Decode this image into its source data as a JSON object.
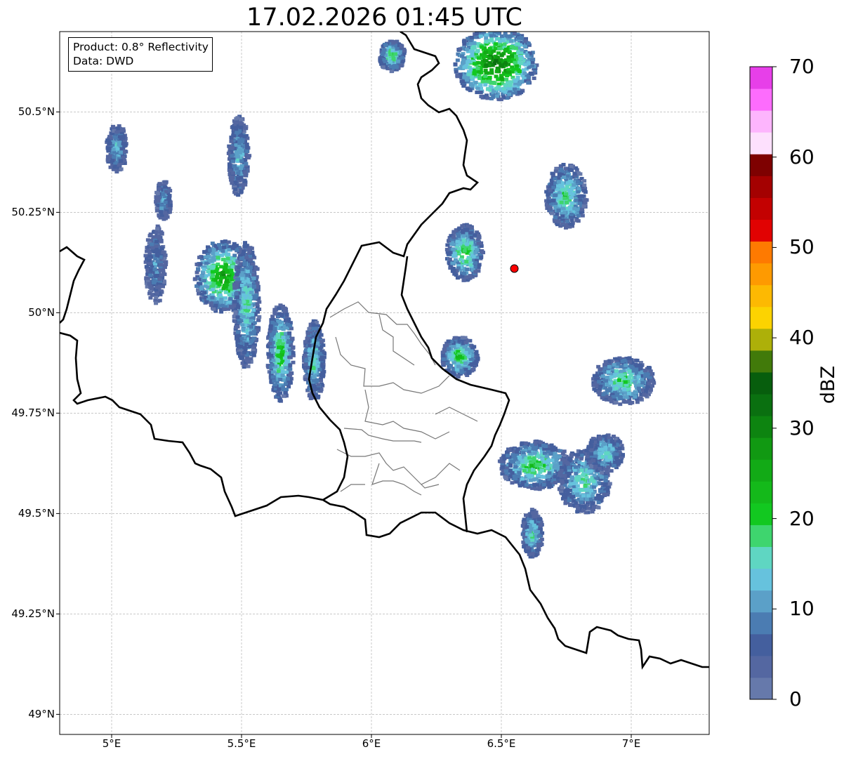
{
  "title": "17.02.2026 01:45 UTC",
  "info_box": {
    "product_line": "Product: 0.8° Reflectivity",
    "data_line": "Data: DWD"
  },
  "map": {
    "lon_range": [
      4.8,
      7.3
    ],
    "lat_range": [
      48.95,
      50.7
    ],
    "lat_ticks": [
      {
        "value": 50.5,
        "label": "50.5°N"
      },
      {
        "value": 50.25,
        "label": "50.25°N"
      },
      {
        "value": 50.0,
        "label": "50°N"
      },
      {
        "value": 49.75,
        "label": "49.75°N"
      },
      {
        "value": 49.5,
        "label": "49.5°N"
      },
      {
        "value": 49.25,
        "label": "49.25°N"
      },
      {
        "value": 49.0,
        "label": "49°N"
      }
    ],
    "lon_ticks": [
      {
        "value": 5.0,
        "label": "5°E"
      },
      {
        "value": 5.5,
        "label": "5.5°E"
      },
      {
        "value": 6.0,
        "label": "6°E"
      },
      {
        "value": 6.5,
        "label": "6.5°E"
      },
      {
        "value": 7.0,
        "label": "7°E"
      }
    ],
    "grid": true,
    "radar_site": {
      "lon": 6.55,
      "lat": 50.11,
      "color": "#ff0000"
    },
    "echoes": [
      {
        "lon": 5.43,
        "lat": 50.09,
        "rx": 0.11,
        "ry": 0.09,
        "max_dbz": 28
      },
      {
        "lon": 5.52,
        "lat": 50.02,
        "rx": 0.05,
        "ry": 0.16,
        "max_dbz": 18
      },
      {
        "lon": 5.65,
        "lat": 49.9,
        "rx": 0.05,
        "ry": 0.12,
        "max_dbz": 22
      },
      {
        "lon": 5.78,
        "lat": 49.88,
        "rx": 0.04,
        "ry": 0.1,
        "max_dbz": 18
      },
      {
        "lon": 5.49,
        "lat": 50.39,
        "rx": 0.04,
        "ry": 0.1,
        "max_dbz": 14
      },
      {
        "lon": 5.02,
        "lat": 50.41,
        "rx": 0.04,
        "ry": 0.06,
        "max_dbz": 14
      },
      {
        "lon": 5.17,
        "lat": 50.12,
        "rx": 0.04,
        "ry": 0.1,
        "max_dbz": 10
      },
      {
        "lon": 5.2,
        "lat": 50.28,
        "rx": 0.03,
        "ry": 0.05,
        "max_dbz": 12
      },
      {
        "lon": 6.48,
        "lat": 50.62,
        "rx": 0.16,
        "ry": 0.09,
        "max_dbz": 34
      },
      {
        "lon": 6.08,
        "lat": 50.64,
        "rx": 0.05,
        "ry": 0.04,
        "max_dbz": 20
      },
      {
        "lon": 6.75,
        "lat": 50.29,
        "rx": 0.08,
        "ry": 0.08,
        "max_dbz": 20
      },
      {
        "lon": 6.36,
        "lat": 50.15,
        "rx": 0.07,
        "ry": 0.07,
        "max_dbz": 22
      },
      {
        "lon": 6.34,
        "lat": 49.89,
        "rx": 0.07,
        "ry": 0.05,
        "max_dbz": 22
      },
      {
        "lon": 6.63,
        "lat": 49.62,
        "rx": 0.14,
        "ry": 0.06,
        "max_dbz": 22
      },
      {
        "lon": 6.97,
        "lat": 49.83,
        "rx": 0.12,
        "ry": 0.06,
        "max_dbz": 20
      },
      {
        "lon": 6.82,
        "lat": 49.58,
        "rx": 0.1,
        "ry": 0.08,
        "max_dbz": 18
      },
      {
        "lon": 6.62,
        "lat": 49.45,
        "rx": 0.04,
        "ry": 0.06,
        "max_dbz": 18
      },
      {
        "lon": 6.9,
        "lat": 49.65,
        "rx": 0.07,
        "ry": 0.05,
        "max_dbz": 16
      }
    ]
  },
  "colorbar": {
    "label": "dBZ",
    "min": 0,
    "max": 70,
    "ticks": [
      {
        "value": 0,
        "label": "0"
      },
      {
        "value": 10,
        "label": "10"
      },
      {
        "value": 20,
        "label": "20"
      },
      {
        "value": 30,
        "label": "30"
      },
      {
        "value": 40,
        "label": "40"
      },
      {
        "value": 50,
        "label": "50"
      },
      {
        "value": 60,
        "label": "60"
      },
      {
        "value": 70,
        "label": "70"
      }
    ],
    "colors": [
      "#6679ab",
      "#5467a1",
      "#445f9e",
      "#4b7cb2",
      "#5ba0c8",
      "#66c2dd",
      "#5fd6c2",
      "#3ed56e",
      "#12c820",
      "#14b91a",
      "#12aa16",
      "#119912",
      "#0d8410",
      "#0a7010",
      "#075e0d",
      "#417a0a",
      "#adb009",
      "#fcd301",
      "#fdb902",
      "#fe9a01",
      "#fe7a01",
      "#e10202",
      "#c30101",
      "#a40101",
      "#7e0101",
      "#fde0fd",
      "#fdb5fd",
      "#fd6cfd",
      "#e73fe9"
    ]
  }
}
